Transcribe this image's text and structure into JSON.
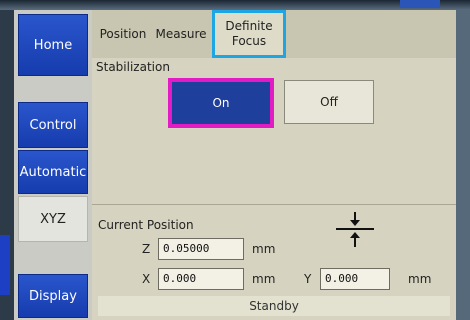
{
  "sidebar": {
    "home": "Home",
    "control": "Control",
    "automatic": "Automatic",
    "xyz": "XYZ",
    "display": "Display"
  },
  "tabs": {
    "position": "Position",
    "measure": "Measure",
    "definite_line1": "Definite",
    "definite_line2": "Focus"
  },
  "stabilization": {
    "label": "Stabilization",
    "on": "On",
    "off": "Off"
  },
  "current_position": {
    "label": "Current Position",
    "z_label": "Z",
    "z_value": "0.05000",
    "z_unit": "mm",
    "x_label": "X",
    "x_value": "0.000",
    "x_unit": "mm",
    "y_label": "Y",
    "y_value": "0.000",
    "y_unit": "mm"
  },
  "status": "Standby",
  "colors": {
    "button_blue": "#1f48c0",
    "selected_on": "#1f3f9c",
    "panel_bg": "#d6d4c0",
    "highlight_magenta": "#e21cc4",
    "highlight_cyan": "#1ea5e4"
  },
  "icons": {
    "focus": "focus-arrows-icon"
  }
}
